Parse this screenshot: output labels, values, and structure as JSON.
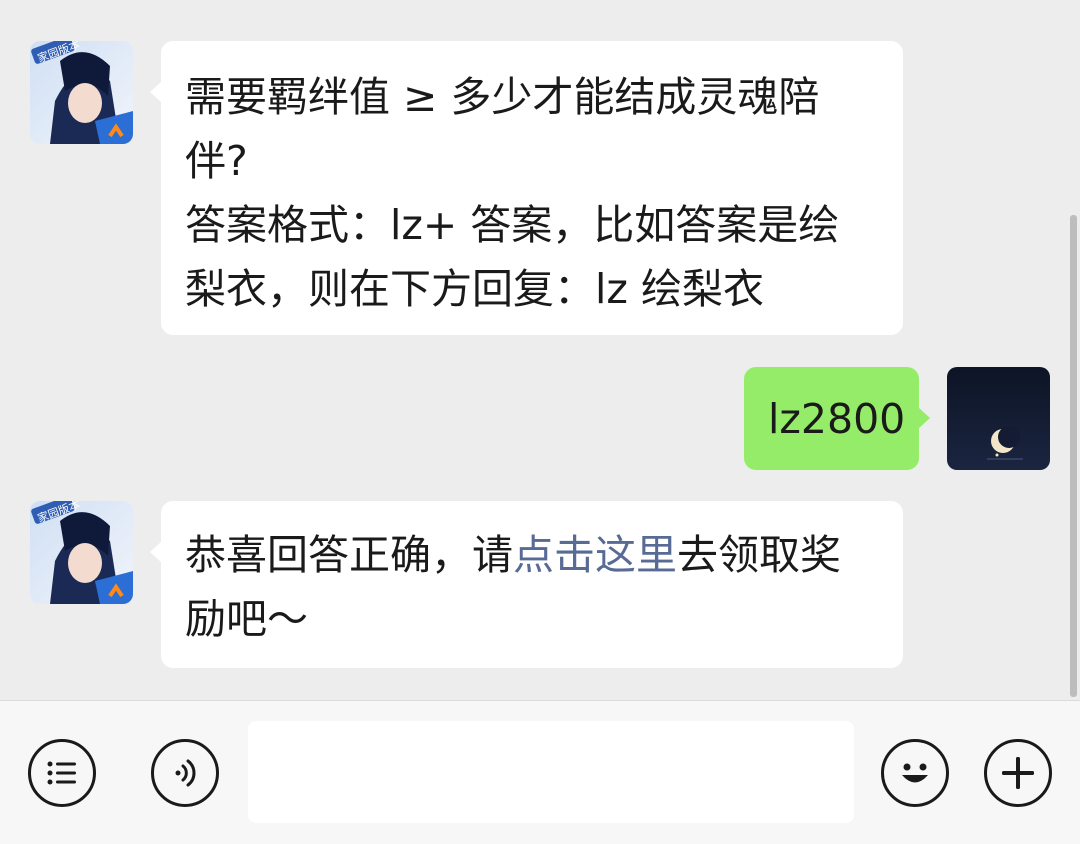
{
  "messages": [
    {
      "sender": "bot",
      "lines": [
        "需要羁绊值 ≥ 多少才能结成灵魂陪",
        "伴?",
        "答案格式：lz+ 答案，比如答案是绘",
        "梨衣，则在下方回复：lz 绘梨衣"
      ],
      "avatar_badge": "家园版本"
    },
    {
      "sender": "user",
      "text": "lz2800"
    },
    {
      "sender": "bot",
      "line1_before": "恭喜回答正确，请",
      "line1_link": "点击这里",
      "line1_after": "去领取奖",
      "line2": "励吧～",
      "avatar_badge": "家园版本"
    }
  ],
  "input_bar": {
    "menu_icon": "list-menu-icon",
    "voice_icon": "voice-icon",
    "emoji_icon": "emoji-icon",
    "add_icon": "plus-icon",
    "input_value": ""
  },
  "colors": {
    "background": "#ededed",
    "incoming_bubble": "#ffffff",
    "outgoing_bubble": "#95ec69",
    "link": "#576b95"
  }
}
